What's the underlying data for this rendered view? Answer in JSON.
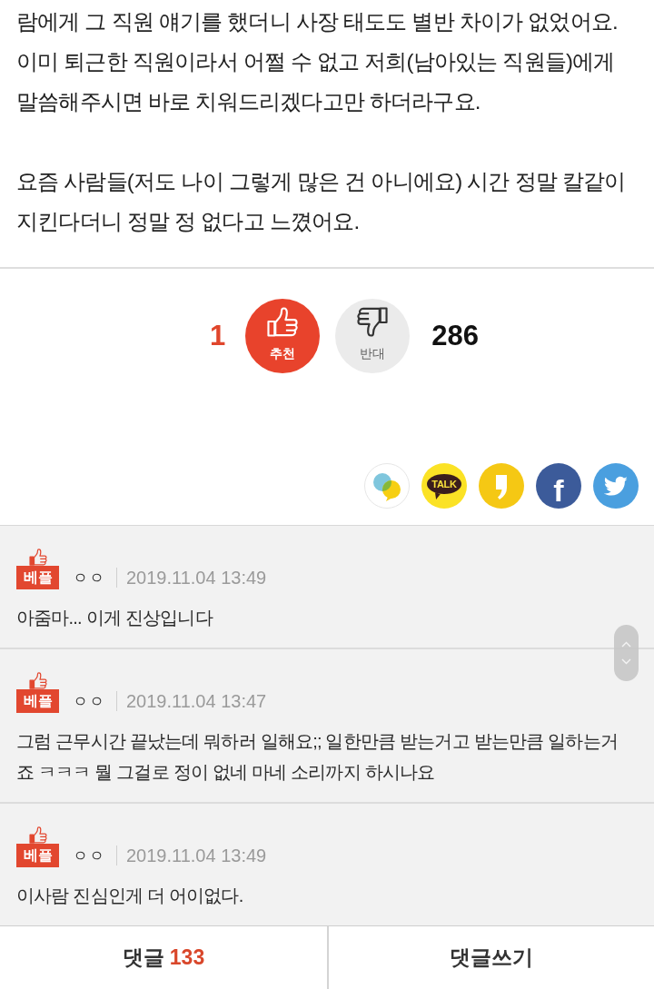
{
  "article": {
    "paragraphs": [
      "람에게 그 직원 얘기를 했더니 사장 태도도 별반 차이가 없었어요. 이미 퇴근한 직원이라서 어쩔 수 없고 저희(남아있는 직원들)에게 말씀해주시면 바로 치워드리겠다고만 하더라구요.",
      "요즘 사람들(저도 나이 그렇게 많은 건 아니에요) 시간 정말 칼같이 지킨다더니 정말 정 없다고 느꼈어요."
    ]
  },
  "votes": [
    {
      "kind": "up",
      "label": "추천",
      "count": "1"
    },
    {
      "kind": "down",
      "label": "반대",
      "count": "286"
    }
  ],
  "share_buttons": [
    {
      "kind": "bubbles"
    },
    {
      "kind": "talk",
      "label": "TALK"
    },
    {
      "kind": "comma"
    },
    {
      "kind": "letter",
      "label": "f"
    },
    {
      "kind": "bird"
    }
  ],
  "comments": [
    {
      "badge": "베플",
      "author": "ㅇㅇ",
      "date": "2019.11.04 13:49",
      "text": "아줌마... 이게 진상입니다"
    },
    {
      "badge": "베플",
      "author": "ㅇㅇ",
      "date": "2019.11.04 13:47",
      "text": "그럼 근무시간 끝났는데 뭐하러 일해요;; 일한만큼 받는거고 받는만큼 일하는거죠 ㅋㅋㅋ 뭘 그걸로 정이 없네 마네 소리까지 하시나요"
    },
    {
      "badge": "베플",
      "author": "ㅇㅇ",
      "date": "2019.11.04 13:49",
      "text": "이사람 진심인게 더 어이없다."
    }
  ],
  "bottom_bar": {
    "comments_label": "댓글",
    "comment_count": "133",
    "write_label": "댓글쓰기"
  }
}
